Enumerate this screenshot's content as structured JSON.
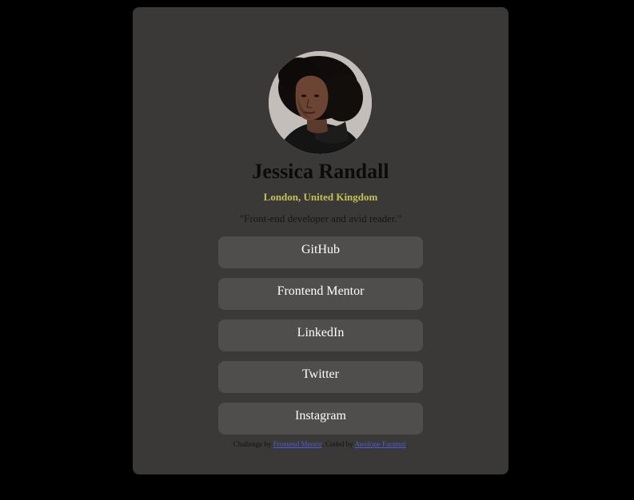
{
  "profile": {
    "name": "Jessica Randall",
    "location": "London, United Kingdom",
    "bio": "\"Front-end developer and avid reader.\"",
    "avatar_alt": "Jessica Randall"
  },
  "links": [
    {
      "label": "GitHub"
    },
    {
      "label": "Frontend Mentor"
    },
    {
      "label": "LinkedIn"
    },
    {
      "label": "Twitter"
    },
    {
      "label": "Instagram"
    }
  ],
  "attribution": {
    "prefix": "Challenge by ",
    "challenge_link": "Frontend Mentor",
    "middle": ". Coded by ",
    "author_link": "Awolope Faramni",
    "suffix": "."
  },
  "colors": {
    "page_background": "#000000",
    "card_background": "#3a3937",
    "button_background": "#4f4e4c",
    "location_accent": "#c4c15a",
    "link_color": "#4f5bd5"
  }
}
